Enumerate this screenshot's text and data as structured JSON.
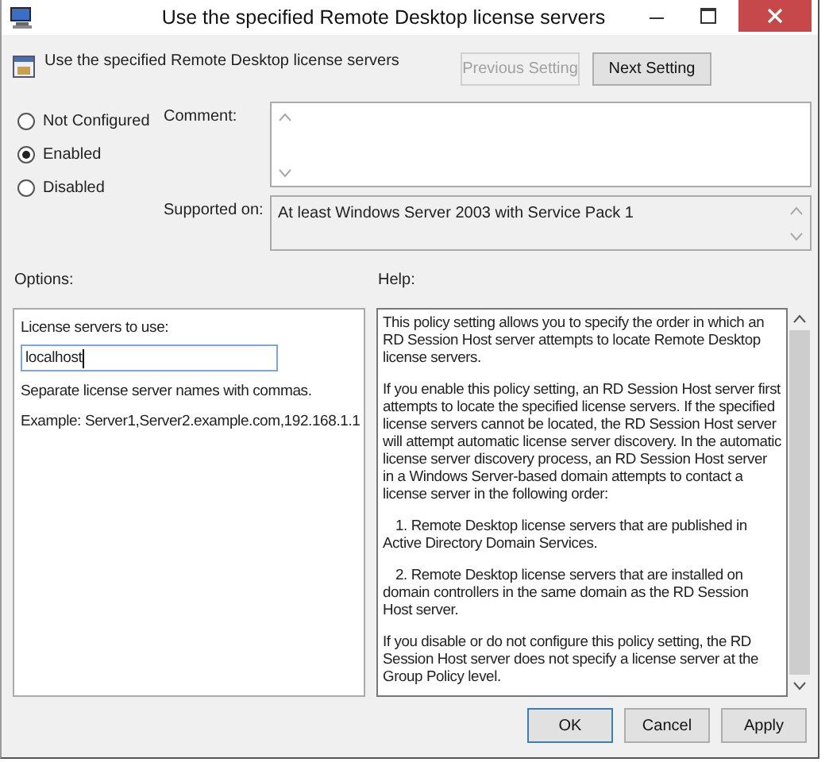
{
  "window": {
    "title": "Use the specified Remote Desktop license servers"
  },
  "header": {
    "title": "Use the specified Remote Desktop license servers",
    "buttons": [
      {
        "label": "Previous Setting",
        "disabled": true
      },
      {
        "label": "Next Setting",
        "disabled": false
      }
    ]
  },
  "states": [
    {
      "label": "Not Configured",
      "selected": false
    },
    {
      "label": "Enabled",
      "selected": true
    },
    {
      "label": "Disabled",
      "selected": false
    }
  ],
  "comment": {
    "label": "Comment:"
  },
  "supported": {
    "label": "Supported on:",
    "value": "At least Windows Server 2003 with Service Pack 1"
  },
  "options": {
    "label": "Options:",
    "items": [
      {
        "kind": "label",
        "text": "License servers to use:"
      },
      {
        "kind": "input",
        "value": "localhost"
      },
      {
        "kind": "text",
        "text": "Separate license server names with commas."
      },
      {
        "kind": "text",
        "text": "Example: Server1,Server2.example.com,192.168.1.1"
      }
    ]
  },
  "help": {
    "label": "Help:",
    "paragraphs": [
      {
        "kind": "para",
        "text": "This policy setting allows you to specify the order in which an RD Session Host server attempts to locate Remote Desktop license servers."
      },
      {
        "kind": "para",
        "text": "If you enable this policy setting, an RD Session Host server first attempts to locate the specified license servers. If the specified license servers cannot be located, the RD Session Host server will attempt automatic license server discovery. In the automatic license server discovery process, an RD Session Host server in a Windows Server-based domain attempts to contact a license server in the following order:"
      },
      {
        "kind": "item",
        "text": "1. Remote Desktop license servers that are published in Active Directory Domain Services."
      },
      {
        "kind": "item",
        "text": "2. Remote Desktop license servers that are installed on domain controllers in the same domain as the RD Session Host server."
      },
      {
        "kind": "para",
        "text": "If you disable or do not configure this policy setting, the RD Session Host server does not specify a license server at the Group Policy level."
      }
    ]
  },
  "footer": {
    "buttons": [
      {
        "label": "OK",
        "default": true
      },
      {
        "label": "Cancel",
        "default": false
      },
      {
        "label": "Apply",
        "default": false
      }
    ]
  }
}
